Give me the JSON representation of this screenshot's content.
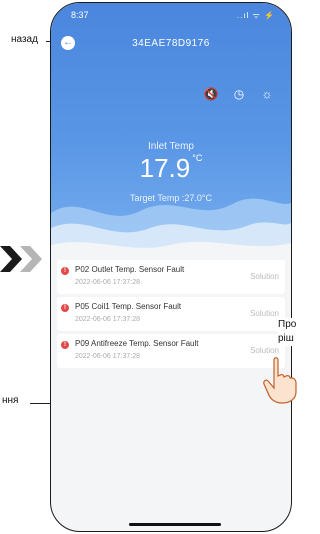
{
  "status_bar": {
    "time": "8:37",
    "icons": "..ıl ᯤ ⚡"
  },
  "header": {
    "device_id": "34EAE78D9176",
    "back_icon": "circle-arrow-left"
  },
  "toolbar": {
    "icons": [
      "mute-icon",
      "clock-icon",
      "sun-icon"
    ]
  },
  "temperature": {
    "label": "Inlet Temp",
    "value": "17.9",
    "unit": "°C",
    "target": "Target Temp :27.0°C"
  },
  "faults": [
    {
      "title": "P02 Outlet Temp. Sensor Fault",
      "time": "2022-06-06 17:37:28",
      "action": "Solution"
    },
    {
      "title": "P05 Coil1 Temp. Sensor Fault",
      "time": "2022-06-06 17:37:28",
      "action": "Solution"
    },
    {
      "title": "P09 Antifreeze Temp. Sensor Fault",
      "time": "2022-06-06 17:37:28",
      "action": "Solution"
    }
  ],
  "annotations": {
    "back": "назад",
    "solution": "Про рiш",
    "fault": "ння"
  },
  "colors": {
    "hero": "#4a86dd",
    "fault_dot": "#e24a4a"
  }
}
